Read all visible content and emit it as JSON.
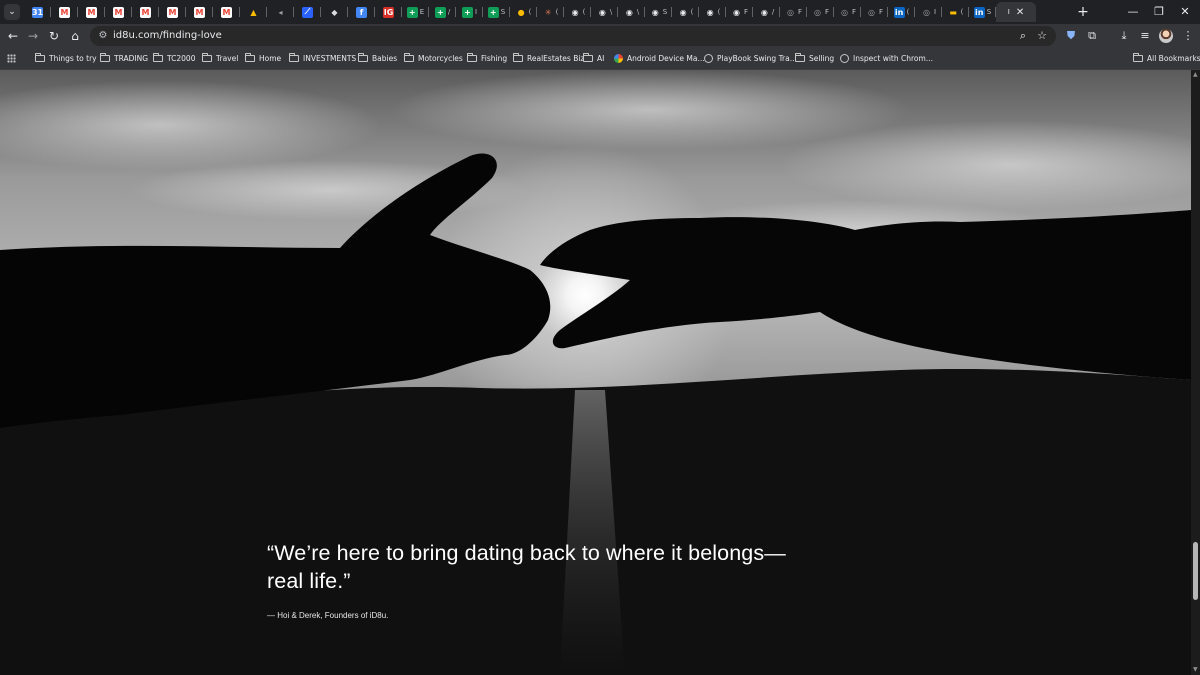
{
  "browser": {
    "tabs": [
      {
        "icon": "calendar-favicon",
        "color": "#4285f4",
        "glyph": "31"
      },
      {
        "icon": "gmail-favicon",
        "color": "#ea4335",
        "glyph": "M"
      },
      {
        "icon": "gmail-favicon",
        "color": "#ea4335",
        "glyph": "M"
      },
      {
        "icon": "gmail-favicon",
        "color": "#ea4335",
        "glyph": "M"
      },
      {
        "icon": "gmail-favicon",
        "color": "#ea4335",
        "glyph": "M"
      },
      {
        "icon": "gmail-favicon",
        "color": "#ea4335",
        "glyph": "M"
      },
      {
        "icon": "gmail-favicon",
        "color": "#ea4335",
        "glyph": "M"
      },
      {
        "icon": "gmail-favicon",
        "color": "#ea4335",
        "glyph": "M"
      },
      {
        "icon": "drive-favicon",
        "color": "#fbbc04",
        "glyph": "▲"
      },
      {
        "icon": "audio-favicon",
        "color": "#9aa0a6",
        "glyph": "◂"
      },
      {
        "icon": "tradingview-favicon",
        "color": "#2962ff",
        "glyph": "⟋"
      },
      {
        "icon": "shield-favicon",
        "color": "#dadce0",
        "glyph": "◆"
      },
      {
        "icon": "blue-circle-favicon",
        "color": "#4285f4",
        "glyph": "f"
      },
      {
        "icon": "ig-favicon",
        "color": "#d93025",
        "glyph": "IG"
      },
      {
        "icon": "sheets-favicon",
        "color": "#0f9d58",
        "glyph": "+",
        "label": "E"
      },
      {
        "icon": "sheets-favicon",
        "color": "#0f9d58",
        "glyph": "+",
        "label": "/"
      },
      {
        "icon": "sheets-favicon",
        "color": "#0f9d58",
        "glyph": "+",
        "label": "I"
      },
      {
        "icon": "sheets-favicon",
        "color": "#0f9d58",
        "glyph": "+",
        "label": "S"
      },
      {
        "icon": "yellow-circle-favicon",
        "color": "#fbbc04",
        "glyph": "●",
        "label": "("
      },
      {
        "icon": "claude-favicon",
        "color": "#d97757",
        "glyph": "✳",
        "label": "("
      },
      {
        "icon": "github-favicon",
        "color": "#e8eaed",
        "glyph": "◉",
        "label": "("
      },
      {
        "icon": "github-favicon",
        "color": "#e8eaed",
        "glyph": "◉",
        "label": "\\"
      },
      {
        "icon": "github-favicon",
        "color": "#e8eaed",
        "glyph": "◉",
        "label": "\\"
      },
      {
        "icon": "github-favicon",
        "color": "#e8eaed",
        "glyph": "◉",
        "label": "S"
      },
      {
        "icon": "github-favicon",
        "color": "#e8eaed",
        "glyph": "◉",
        "label": "("
      },
      {
        "icon": "github-favicon",
        "color": "#e8eaed",
        "glyph": "◉",
        "label": "("
      },
      {
        "icon": "github-favicon",
        "color": "#e8eaed",
        "glyph": "◉",
        "label": "F"
      },
      {
        "icon": "github-favicon",
        "color": "#e8eaed",
        "glyph": "◉",
        "label": "/"
      },
      {
        "icon": "globe-favicon",
        "color": "#9aa0a6",
        "glyph": "◎",
        "label": "F"
      },
      {
        "icon": "globe-favicon",
        "color": "#9aa0a6",
        "glyph": "◎",
        "label": "F"
      },
      {
        "icon": "globe-favicon",
        "color": "#9aa0a6",
        "glyph": "◎",
        "label": "F"
      },
      {
        "icon": "globe-favicon",
        "color": "#9aa0a6",
        "glyph": "◎",
        "label": "F"
      },
      {
        "icon": "linkedin-favicon",
        "color": "#0a66c2",
        "glyph": "in",
        "label": "("
      },
      {
        "icon": "globe-favicon",
        "color": "#9aa0a6",
        "glyph": "◎",
        "label": "I"
      },
      {
        "icon": "colorbar-favicon",
        "color": "#fbbc04",
        "glyph": "▬",
        "label": "("
      },
      {
        "icon": "linkedin-favicon",
        "color": "#0a66c2",
        "glyph": "in",
        "label": "S"
      }
    ],
    "active_tab": {
      "label": "I",
      "close": "✕"
    },
    "new_tab": "+",
    "window_controls": {
      "minimize": "—",
      "restore": "❐",
      "close": "✕"
    },
    "url": "id8u.com/finding-love"
  },
  "bookmarks": [
    {
      "label": "Things to try",
      "type": "folder"
    },
    {
      "label": "TRADING",
      "type": "folder"
    },
    {
      "label": "TC2000",
      "type": "folder"
    },
    {
      "label": "Travel",
      "type": "folder"
    },
    {
      "label": "Home",
      "type": "folder"
    },
    {
      "label": "INVESTMENTS",
      "type": "folder"
    },
    {
      "label": "Babies",
      "type": "folder"
    },
    {
      "label": "Motorcycles",
      "type": "folder"
    },
    {
      "label": "Fishing",
      "type": "folder"
    },
    {
      "label": "RealEstates Biz",
      "type": "folder"
    },
    {
      "label": "AI",
      "type": "folder"
    },
    {
      "label": "Android Device Ma...",
      "type": "link"
    },
    {
      "label": "PlayBook Swing Tra...",
      "type": "link"
    },
    {
      "label": "Selling",
      "type": "folder"
    },
    {
      "label": "Inspect with Chrom...",
      "type": "link"
    },
    {
      "label": "All Bookmarks",
      "type": "folder"
    }
  ],
  "hero": {
    "quote": "“We’re here to bring dating back to where it belongs—real life.”",
    "attribution": "— Hoi & Derek, Founders of iD8u."
  },
  "scrollbar": {
    "position": 0.9
  }
}
